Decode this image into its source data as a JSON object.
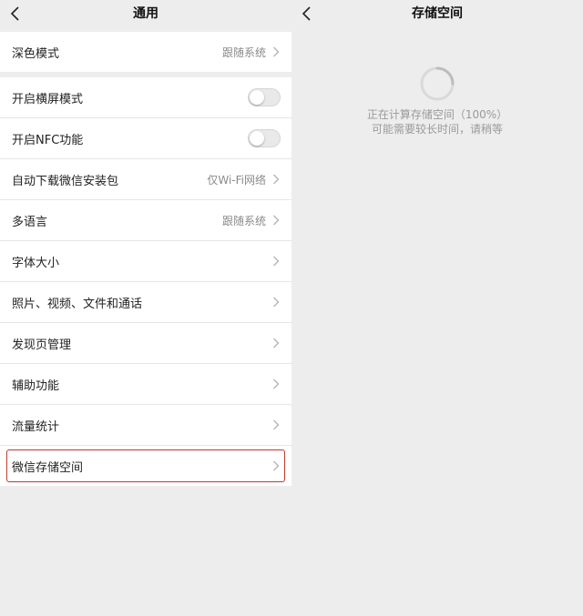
{
  "left": {
    "title": "通用",
    "group1": [
      {
        "label": "深色模式",
        "value": "跟随系统"
      }
    ],
    "group2": [
      {
        "label": "开启横屏模式",
        "toggle": false
      },
      {
        "label": "开启NFC功能",
        "toggle": false
      },
      {
        "label": "自动下载微信安装包",
        "value": "仅Wi-Fi网络"
      },
      {
        "label": "多语言",
        "value": "跟随系统"
      },
      {
        "label": "字体大小"
      },
      {
        "label": "照片、视频、文件和通话"
      },
      {
        "label": "发现页管理"
      },
      {
        "label": "辅助功能"
      },
      {
        "label": "流量统计"
      },
      {
        "label": "微信存储空间",
        "highlighted": true
      }
    ]
  },
  "right": {
    "title": "存储空间",
    "loading_line1": "正在计算存储空间（100%）",
    "loading_line2": "可能需要较长时间，请稍等",
    "progress_percent": 100
  },
  "colors": {
    "highlight": "#c0392b",
    "background": "#ededed"
  }
}
